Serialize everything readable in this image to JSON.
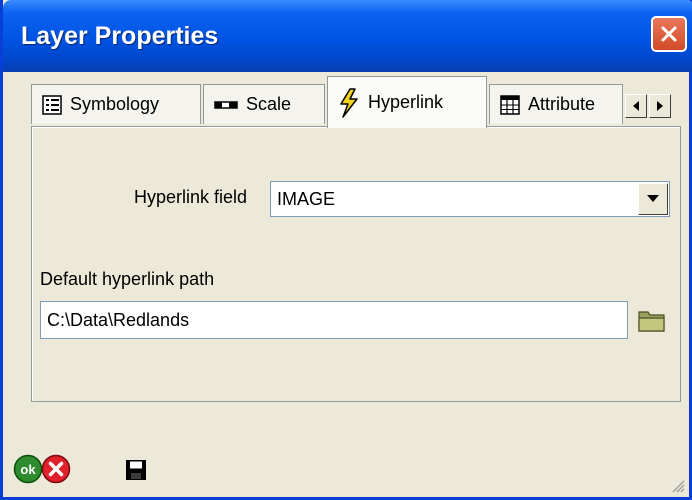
{
  "window": {
    "title": "Layer Properties",
    "close_icon": "close-icon"
  },
  "tabs": [
    {
      "label": "Symbology",
      "icon": "list-icon",
      "active": false
    },
    {
      "label": "Scale",
      "icon": "scale-bar-icon",
      "active": false
    },
    {
      "label": "Hyperlink",
      "icon": "lightning-icon",
      "active": true
    },
    {
      "label": "Attribute",
      "icon": "table-icon",
      "active": false
    }
  ],
  "tab_scroll": {
    "left_icon": "arrow-left-icon",
    "right_icon": "arrow-right-icon"
  },
  "hyperlink_panel": {
    "field_label": "Hyperlink field",
    "field_value": "IMAGE",
    "path_label": "Default hyperlink path",
    "path_value": "C:\\Data\\Redlands",
    "browse_icon": "folder-icon"
  },
  "footer": {
    "ok_label": "ok",
    "ok_color": "#2E8B2E",
    "cancel_color": "#E0202A",
    "save_icon": "floppy-disk-icon"
  },
  "colors": {
    "titlebar": "#0054E3",
    "close": "#D24B27",
    "face": "#ECE9D8"
  }
}
